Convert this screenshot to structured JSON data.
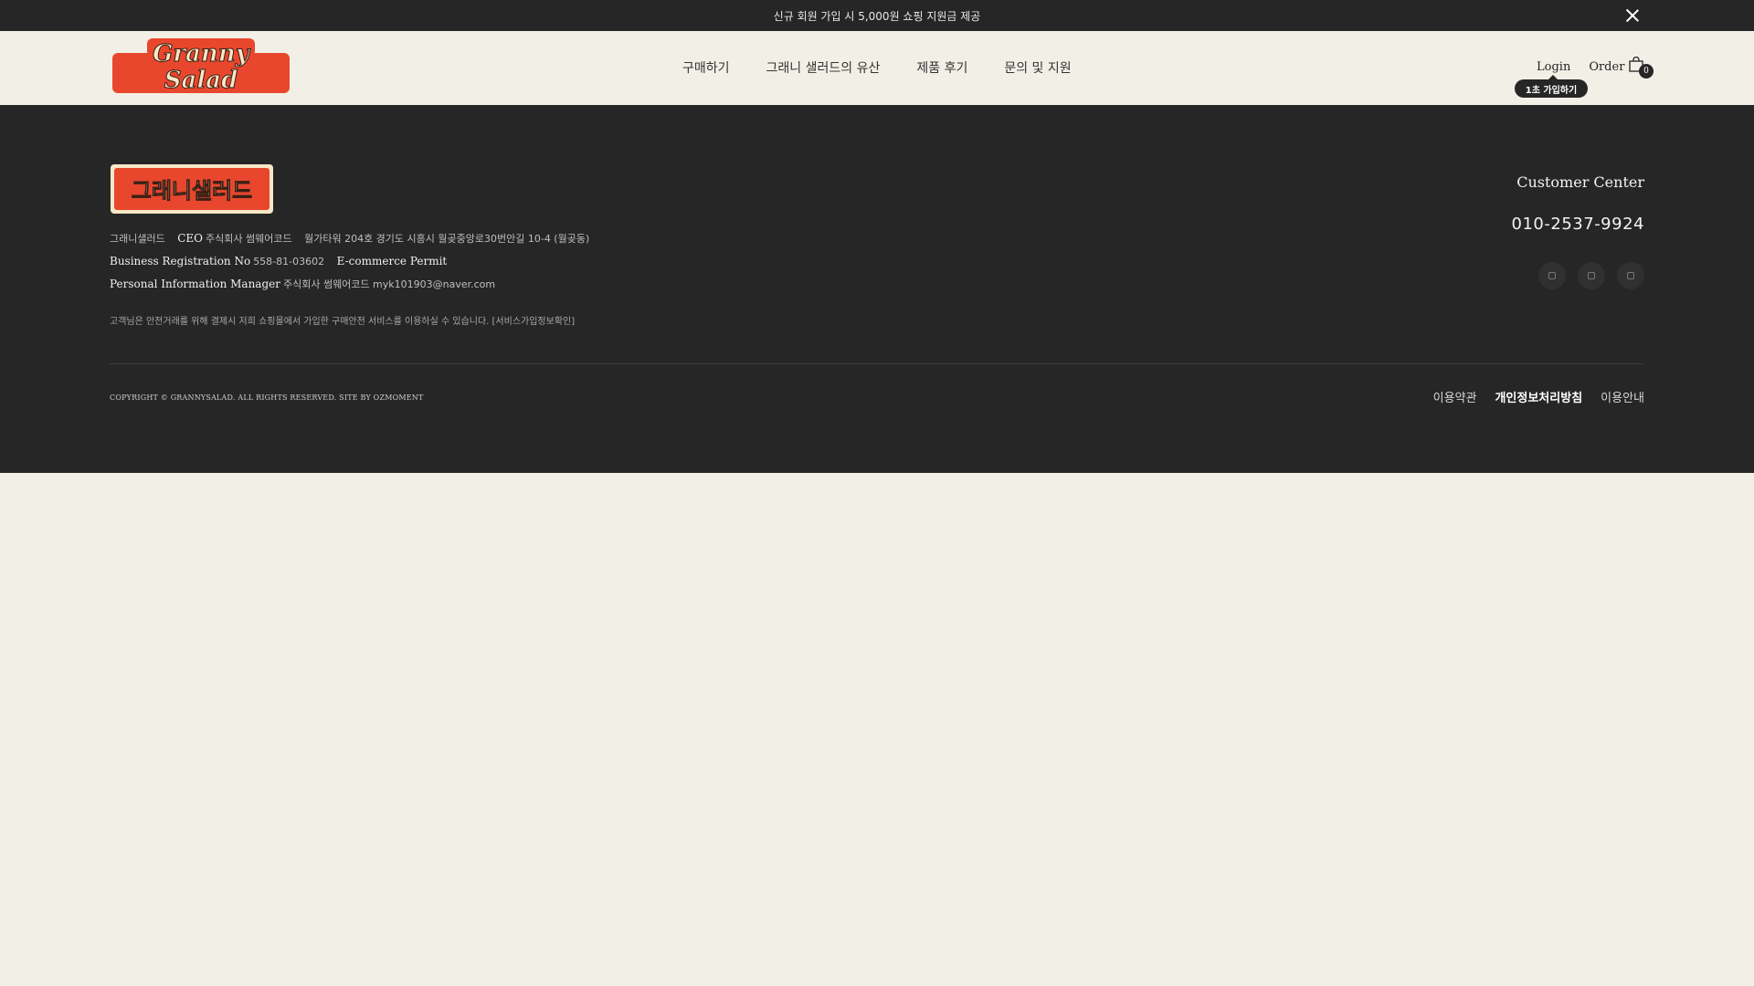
{
  "promo": {
    "text": "신규 회원 가입 시 5,000원 쇼핑 지원금 제공"
  },
  "header": {
    "logo_text_1": "Granny",
    "logo_text_2": "Salad",
    "nav": [
      {
        "label": "구매하기"
      },
      {
        "label": "그래니 샐러드의 유산"
      },
      {
        "label": "제품 후기"
      },
      {
        "label": "문의 및 지원"
      }
    ],
    "login_label": "Login",
    "join_badge": "1초 가입하기",
    "order_label": "Order",
    "cart_count": "0"
  },
  "footer": {
    "logo_text": "그래니샐러드",
    "company_name": "그래니샐러드",
    "ceo_label": "CEO",
    "ceo_value": "주식회사 썸웨어코드",
    "address": "월가타워 204호 경기도 시흥시 월곶중앙로30번안길 10-4 (월곶동)",
    "brn_label": "Business Registration No",
    "brn_value": "558-81-03602",
    "ecommerce_label": "E-commerce Permit",
    "pim_label": "Personal Information Manager",
    "pim_value": "주식회사 썸웨어코드 myk101903@naver.com",
    "notice": "고객님은 안전거래를 위해 결제시 저희 쇼핑몰에서 가입한 구매안전 서비스를 이용하실 수 있습니다. [서비스가입정보확인]",
    "customer_center_title": "Customer Center",
    "phone": "010-2537-9924",
    "socials": [
      "instagram-icon",
      "blog-icon",
      "kakao-icon"
    ],
    "copyright": "COPYRIGHT © GRANNYSALAD. ALL RIGHTS RESERVED. SITE BY OZMOMENT",
    "links": [
      {
        "label": "이용약관"
      },
      {
        "label": "개인정보처리방침"
      },
      {
        "label": "이용안내"
      }
    ]
  },
  "colors": {
    "background": "#f2f0e6",
    "dark": "#262626",
    "brand_red": "#e8472e",
    "brand_cream": "#f6e7c7"
  }
}
